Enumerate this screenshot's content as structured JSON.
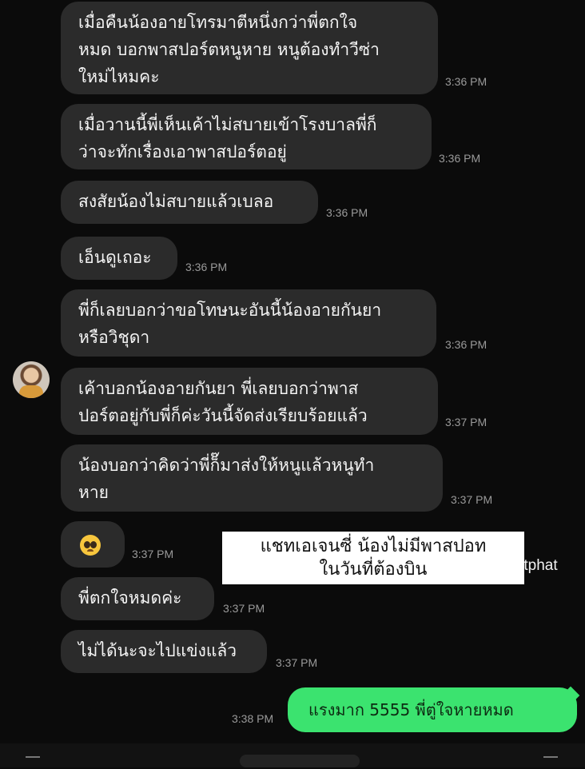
{
  "chat": {
    "messages": [
      {
        "text": "เมื่อคืนน้องอายโทรมาตีหนึ่งกว่าพี่ตกใจ\nหมด บอกพาสปอร์ตหนูหาย หนูต้องทำวีซ่า\nใหม่ไหมคะ",
        "time": "3:36 PM"
      },
      {
        "text": "เมื่อวานนี้พี่เห็นเค้าไม่สบายเข้าโรงบาลพี่ก็\nว่าจะทักเรื่องเอาพาสปอร์ตอยู่",
        "time": "3:36 PM"
      },
      {
        "text": "สงสัยน้องไม่สบายแล้วเบลอ",
        "time": "3:36 PM"
      },
      {
        "text": "เอ็นดูเถอะ",
        "time": "3:36 PM"
      },
      {
        "text": "พี่ก็เลยบอกว่าขอโทษนะอันนี้น้องอายกันยา\nหรือวิชุดา",
        "time": "3:36 PM"
      },
      {
        "text": "เค้าบอกน้องอายกันยา พี่เลยบอกว่าพาส\nปอร์ตอยู่กับพี่ก็ค่ะวันนี้จัดส่งเรียบร้อยแล้ว",
        "time": "3:37 PM"
      },
      {
        "text": "น้องบอกว่าคิดว่าพี่ก็๊มาส่งให้หนูแล้วหนูทำ\nหาย",
        "time": "3:37 PM"
      },
      {
        "emoji": "pleading-face",
        "time": "3:37 PM"
      },
      {
        "text": "พี่ตกใจหมดค่ะ",
        "time": "3:37 PM"
      },
      {
        "text": "ไม่ได้นะจะไปแข่งแล้ว",
        "time": "3:37 PM"
      }
    ],
    "sent": {
      "text": "แรงมาก 5555 พี่ตู่ใจหายหมด",
      "time": "3:38 PM"
    }
  },
  "overlay": {
    "caption": "แชทเอเจนซี่ น้องไม่มีพาสปอท\nในวันที่ต้องบิน",
    "watermark": "IG@atom_lalitphat"
  },
  "colors": {
    "incoming_bubble": "#2b2b2b",
    "sent_bubble": "#3be36f",
    "background": "#0b0b0b"
  }
}
